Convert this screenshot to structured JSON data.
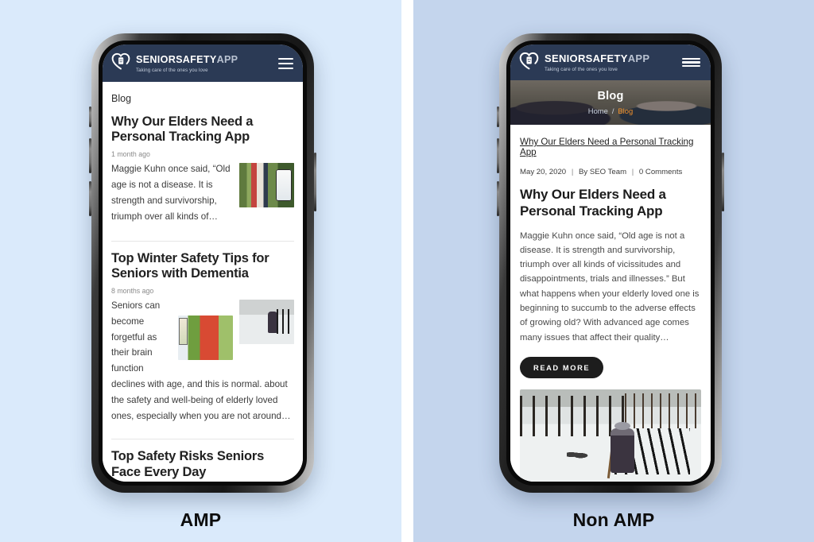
{
  "panels": {
    "amp": {
      "caption": "AMP",
      "background": "#daeafb",
      "header": {
        "brand_main": "SENIORSAFETY",
        "brand_suffix": "APP",
        "tagline": "Taking care of the ones you love",
        "menu_icon": "hamburger-icon",
        "bg_color": "#2b3a55"
      },
      "kicker": "Blog",
      "articles": [
        {
          "title": "Why Our Elders Need a Personal Tracking App",
          "date": "1 month ago",
          "excerpt": "Maggie Kuhn once said, “Old age is not a disease. It is strength and survivorship, triumph over all kinds of…",
          "thumb_alt": "seniors-walking-with-tracking-app-photo"
        },
        {
          "title": "Top Winter Safety Tips for Seniors with Dementia",
          "date": "8 months ago",
          "excerpt": "Seniors can become forgetful as their brain function declines with age, and this is normal. about the safety and well-being of elderly loved ones, especially when you are not around…",
          "thumb_alt": "senior-on-snowy-park-bench-photo",
          "thumb2_alt": "senior-cycling-outdoors-photo"
        },
        {
          "title": "Top Safety Risks Seniors Face Every Day",
          "date": "",
          "excerpt": ""
        }
      ]
    },
    "nonamp": {
      "caption": "Non AMP",
      "background": "#c4d5ed",
      "header": {
        "brand_main": "SENIORSAFETY",
        "brand_suffix": "APP",
        "tagline": "Taking care of the ones you love",
        "menu_icon": "hamburger-icon",
        "bg_color": "#2b3a55"
      },
      "hero": {
        "title": "Blog",
        "photo_alt": "elderly-couple-talking-outdoors-photo",
        "breadcrumb": {
          "home": "Home",
          "separator": "/",
          "current": "Blog",
          "current_color": "#f2922b"
        }
      },
      "post": {
        "permalink_text": "Why Our Elders Need a Personal Tracking App",
        "meta": {
          "date": "May 20, 2020",
          "author": "By SEO Team",
          "comments": "0 Comments",
          "separator": "|"
        },
        "title": "Why Our Elders Need a Personal Tracking App",
        "excerpt": "Maggie Kuhn once said, “Old age is not a disease. It is strength and survivorship, triumph over all kinds of vicissitudes and disappointments, trials and illnesses.” But what happens when your elderly loved one is beginning to succumb to the adverse effects of growing old? With advanced age comes many issues that affect their quality…",
        "read_more": "READ MORE",
        "featured_image_alt": "senior-sitting-on-bench-in-snowy-park-photo"
      }
    }
  }
}
